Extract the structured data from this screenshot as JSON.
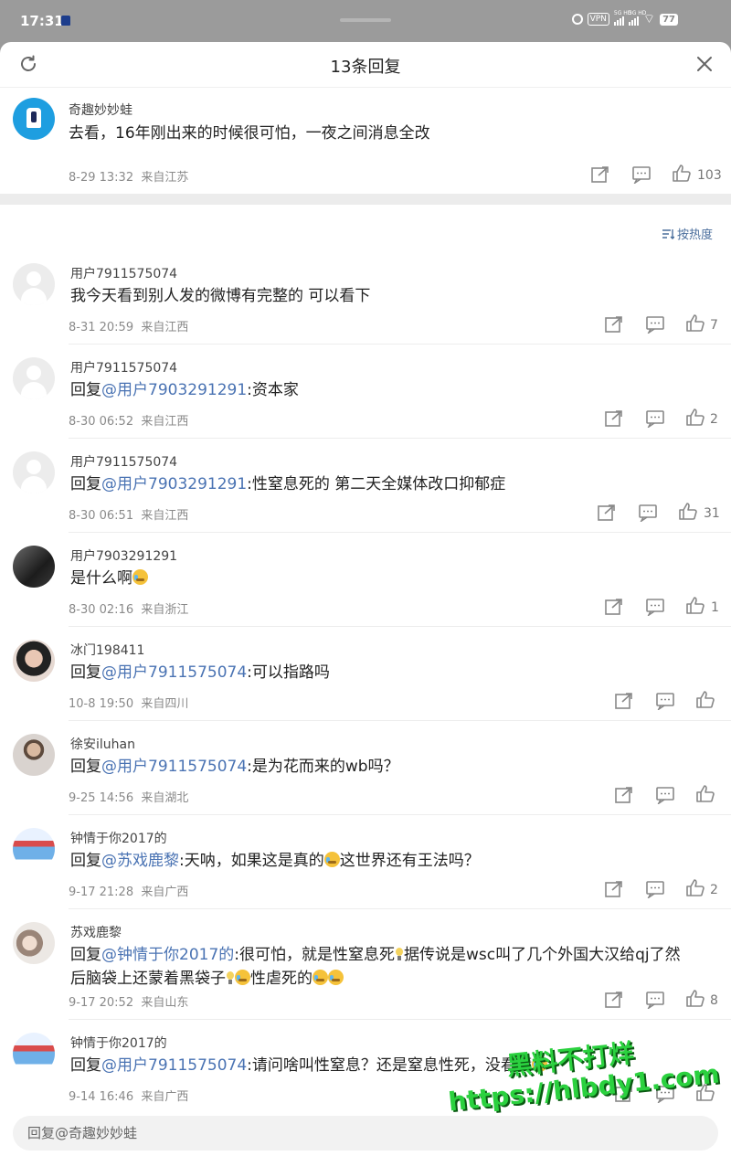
{
  "status_bar": {
    "time": "17:31",
    "vpn": "VPN",
    "signal1": "5G HD",
    "signal2": "5G HD",
    "battery": "77"
  },
  "header": {
    "title": "13条回复"
  },
  "root_comment": {
    "user": "奇趣妙妙蛙",
    "text": "去看，16年刚出来的时候很可怕，一夜之间消息全改",
    "time": "8-29 13:32",
    "location": "来自江苏",
    "likes": "103"
  },
  "sort": {
    "label": "按热度"
  },
  "replies": [
    {
      "user": "用户7911575074",
      "text": "我今天看到别人发的微博有完整的 可以看下",
      "time": "8-31 20:59",
      "location": "来自江西",
      "likes": "7"
    },
    {
      "user": "用户7911575074",
      "prefix": "回复",
      "mention": "@用户7903291291",
      "text": ":资本家",
      "time": "8-30 06:52",
      "location": "来自江西",
      "likes": "2"
    },
    {
      "user": "用户7911575074",
      "prefix": "回复",
      "mention": "@用户7903291291",
      "text": ":性窒息死的 第二天全媒体改口抑郁症",
      "time": "8-30 06:51",
      "location": "来自江西",
      "likes": "31"
    },
    {
      "user": "用户7903291291",
      "text": "是什么啊",
      "time": "8-30 02:16",
      "location": "来自浙江",
      "likes": "1"
    },
    {
      "user": "冰门198411",
      "prefix": "回复",
      "mention": "@用户7911575074",
      "text": ":可以指路吗",
      "time": "10-8 19:50",
      "location": "来自四川",
      "likes": ""
    },
    {
      "user": "徐安iluhan",
      "prefix": "回复",
      "mention": "@用户7911575074",
      "text": ":是为花而来的wb吗？",
      "time": "9-25 14:56",
      "location": "来自湖北",
      "likes": ""
    },
    {
      "user": "钟情于你2017的",
      "prefix": "回复",
      "mention": "@苏戏鹿黎",
      "text_a": ":天呐，如果这是真的",
      "text_b": "这世界还有王法吗？",
      "time": "9-17 21:28",
      "location": "来自广西",
      "likes": "2"
    },
    {
      "user": "苏戏鹿黎",
      "prefix": "回复",
      "mention": "@钟情于你2017的",
      "text_a": ":很可怕，就是性窒息死",
      "text_b": "据传说是wsc叫了几个外国大汉给qj了然",
      "text_c": "后脑袋上还蒙着黑袋子",
      "text_d": "性虐死的",
      "time": "9-17 20:52",
      "location": "来自山东",
      "likes": "8"
    },
    {
      "user": "钟情于你2017的",
      "prefix": "回复",
      "mention": "@用户7911575074",
      "text": ":请问啥叫性窒息？还是窒息性死，没看懂",
      "time": "9-14 16:46",
      "location": "来自广西",
      "likes": ""
    }
  ],
  "input": {
    "placeholder": "回复@奇趣妙妙蛙"
  },
  "watermark": {
    "line1": "黑料不打烊",
    "line2": "https://hlbdy1.com"
  },
  "colors": {
    "mention": "#4a73b3",
    "meta": "#8a8a8a",
    "watermark": "#2bd13f"
  }
}
